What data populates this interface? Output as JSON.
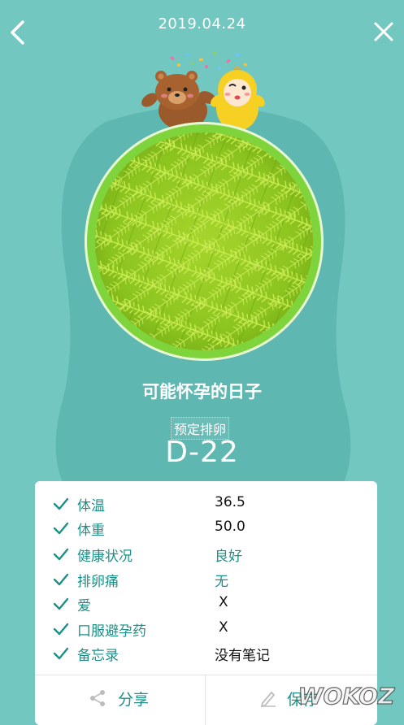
{
  "header": {
    "date": "2019.04.24"
  },
  "main": {
    "headline": "可能怀孕的日子",
    "sub_label": "预定排卵",
    "countdown": "D-22"
  },
  "details": [
    {
      "label": "体温",
      "value": "36.5"
    },
    {
      "label": "体重",
      "value": "50.0"
    },
    {
      "label": "健康状况",
      "value": "良好"
    },
    {
      "label": "排卵痛",
      "value": "无"
    },
    {
      "label": "爱",
      "value": "X"
    },
    {
      "label": "口服避孕药",
      "value": "X"
    },
    {
      "label": "备忘录",
      "value": "没有笔记"
    }
  ],
  "actions": {
    "share": "分享",
    "save": "保存"
  },
  "watermark": "WOKOZ"
}
